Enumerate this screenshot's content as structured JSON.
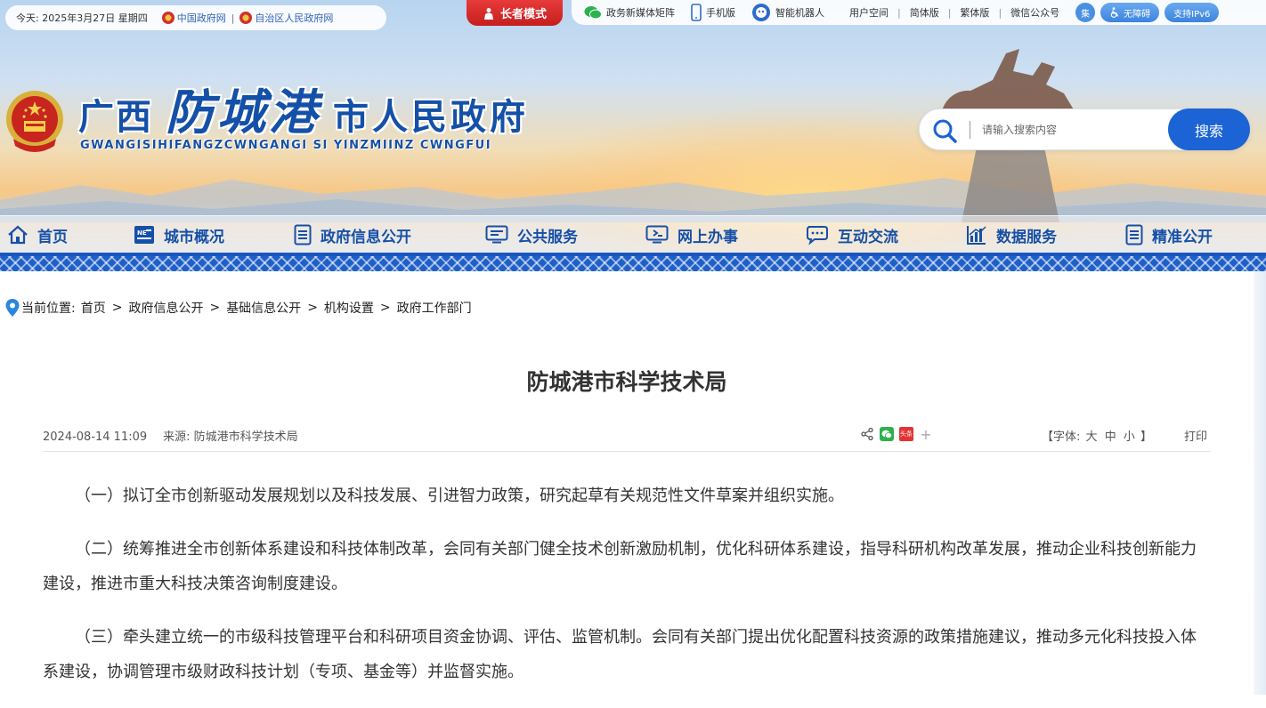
{
  "topbar": {
    "date": "今天: 2025年3月27日  星期四",
    "links": [
      "中国政府网",
      "自治区人民政府网"
    ],
    "elder_mode": "长者模式",
    "right_items": [
      "政务新媒体矩阵",
      "手机版",
      "智能机器人",
      "用户空间",
      "简体版",
      "繁体版",
      "微信公众号"
    ],
    "barrier_free": "无障碍",
    "ipv6": "支持IPv6",
    "collect": "集"
  },
  "site": {
    "title_part1": "广西",
    "title_part2": "防城港",
    "title_part3": "市人民政府",
    "subtitle": "GWANGISIHIFANGZCWNGANGI SI YINZMIINZ CWNGFUI"
  },
  "search": {
    "placeholder": "请输入搜索内容",
    "button": "搜索"
  },
  "nav": {
    "items": [
      {
        "label": "首页",
        "icon": "home-icon"
      },
      {
        "label": "城市概况",
        "icon": "news-icon"
      },
      {
        "label": "政府信息公开",
        "icon": "document-list-icon"
      },
      {
        "label": "公共服务",
        "icon": "monitor-service-icon"
      },
      {
        "label": "网上办事",
        "icon": "monitor-office-icon"
      },
      {
        "label": "互动交流",
        "icon": "chat-icon"
      },
      {
        "label": "数据服务",
        "icon": "chart-icon"
      },
      {
        "label": "精准公开",
        "icon": "document-list-icon"
      }
    ]
  },
  "breadcrumb": {
    "prefix": "当前位置:",
    "items": [
      "首页",
      "政府信息公开",
      "基础信息公开",
      "机构设置",
      "政府工作部门"
    ]
  },
  "article": {
    "title": "防城港市科学技术局",
    "date": "2024-08-14 11:09",
    "source": "来源: 防城港市科学技术局",
    "font_label_open": "【字体:",
    "font_large": "大",
    "font_medium": "中",
    "font_small": "小",
    "font_label_close": "】",
    "print": "打印",
    "share_toutiao": "头条",
    "paragraphs": [
      "（一）拟订全市创新驱动发展规划以及科技发展、引进智力政策，研究起草有关规范性文件草案并组织实施。",
      "（二）统筹推进全市创新体系建设和科技体制改革，会同有关部门健全技术创新激励机制，优化科研体系建设，指导科研机构改革发展，推动企业科技创新能力建设，推进市重大科技决策咨询制度建设。",
      "（三）牵头建立统一的市级科技管理平台和科研项目资金协调、评估、监管机制。会同有关部门提出优化配置科技资源的政策措施建议，推动多元化科技投入体系建设，协调管理市级财政科技计划（专项、基金等）并监督实施。"
    ]
  },
  "colors": {
    "brand_blue": "#1550a8",
    "button_blue": "#1c63d6",
    "elder_red": "#d42a2a"
  }
}
